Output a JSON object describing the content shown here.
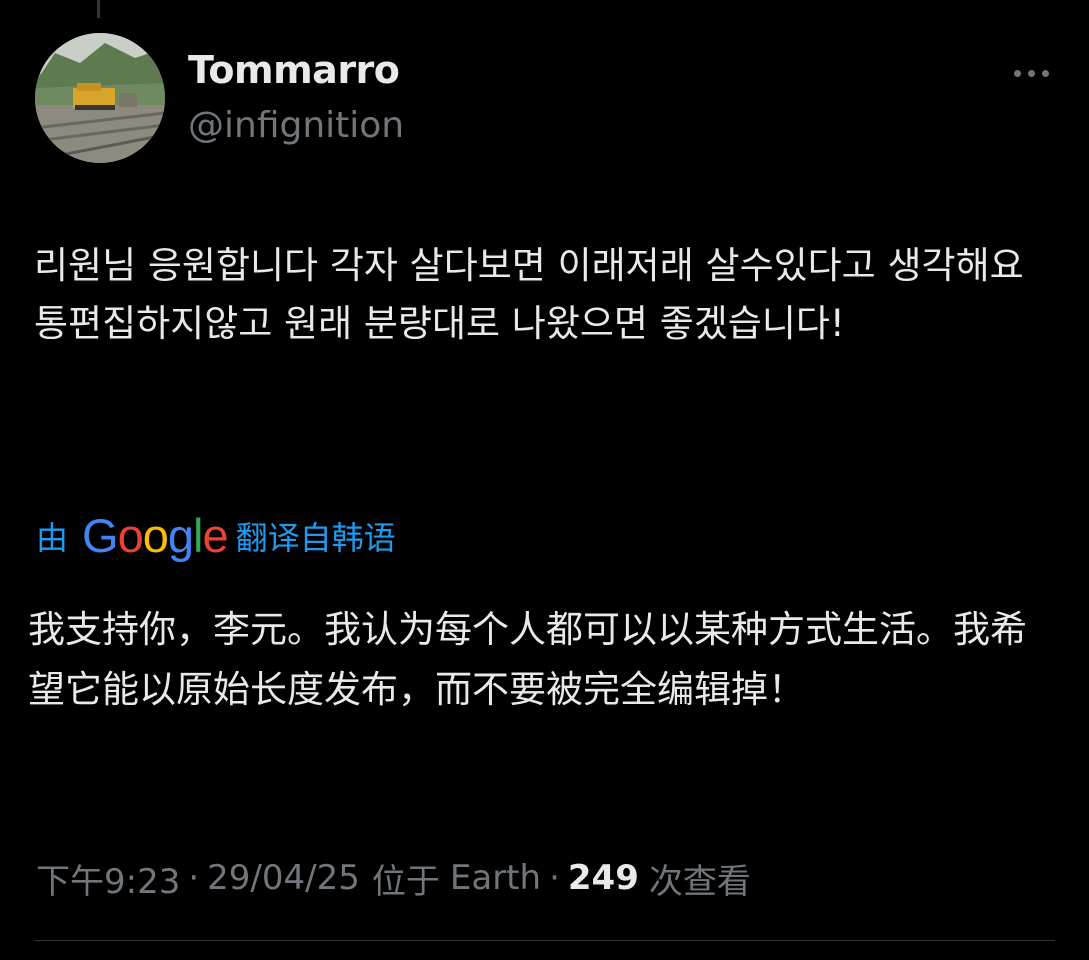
{
  "author": {
    "display_name": "Tommarro",
    "handle": "@infignition",
    "avatar_icon": "avatar-railway-photo"
  },
  "more_icon": "more-horizontal-icon",
  "tweet": {
    "text": "리원님 응원합니다 각자 살다보면 이래저래 살수있다고 생각해요 통편집하지않고 원래 분량대로 나왔으면 좋겠습니다!"
  },
  "translation": {
    "prefix": "由",
    "provider": "Google",
    "suffix": "翻译自韩语",
    "text": "我支持你，李元。我认为每个人都可以以某种方式生活。我希望它能以原始长度发布，而不要被完全编辑掉！"
  },
  "meta": {
    "time": "下午9:23",
    "date": "29/04/25",
    "location_label": "位于",
    "location": "Earth",
    "views_count": "249",
    "views_label": "次查看",
    "separator": "·"
  },
  "colors": {
    "background": "#000000",
    "primary_text": "#e7e9ea",
    "secondary_text": "#71767b",
    "link_blue": "#1d9bf0",
    "google_blue": "#4285f4",
    "google_red": "#ea4335",
    "google_yellow": "#fbbc05",
    "google_green": "#34a853"
  }
}
